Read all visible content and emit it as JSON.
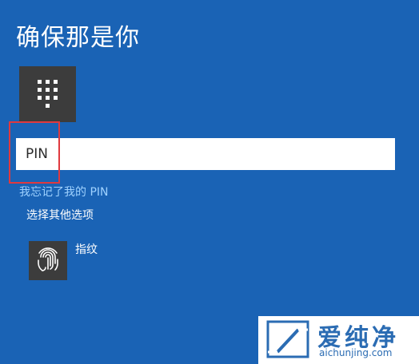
{
  "header": {
    "title": "确保那是你"
  },
  "pin_tile": {
    "icon": "keypad-icon",
    "bg_color": "#3c3c3c"
  },
  "pin_input": {
    "value": "",
    "placeholder": "PIN"
  },
  "links": {
    "forgot_pin": "我忘记了我的 PIN",
    "other_options": "选择其他选项"
  },
  "fingerprint_option": {
    "icon": "fingerprint-icon",
    "label": "指纹"
  },
  "watermark": {
    "cn": "爱纯净",
    "en": "aichunjing.com"
  },
  "colors": {
    "background": "#1a63b5",
    "link": "#9fd2ff",
    "highlight": "#e0393e"
  }
}
